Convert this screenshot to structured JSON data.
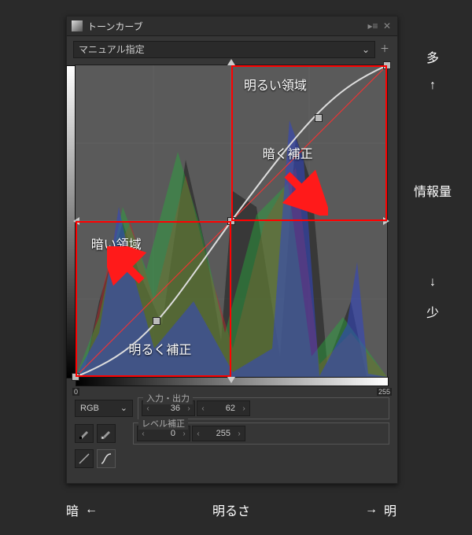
{
  "panel": {
    "title": "トーンカーブ"
  },
  "preset": {
    "selected": "マニュアル指定"
  },
  "channel": {
    "selected": "RGB"
  },
  "io": {
    "legend": "入力・出力",
    "input": "36",
    "output": "62"
  },
  "level": {
    "legend": "レベル補正",
    "low": "0",
    "high": "255"
  },
  "curve_badges": {
    "min": "0",
    "max": "255"
  },
  "annotations": {
    "bright_region": "明るい領域",
    "dark_region": "暗い領域",
    "darken": "暗く補正",
    "brighten": "明るく補正",
    "side_top": "多",
    "side_bottom": "少",
    "side_mid": "情報量",
    "bottom_left": "暗",
    "bottom_center": "明るさ",
    "bottom_right": "明"
  }
}
